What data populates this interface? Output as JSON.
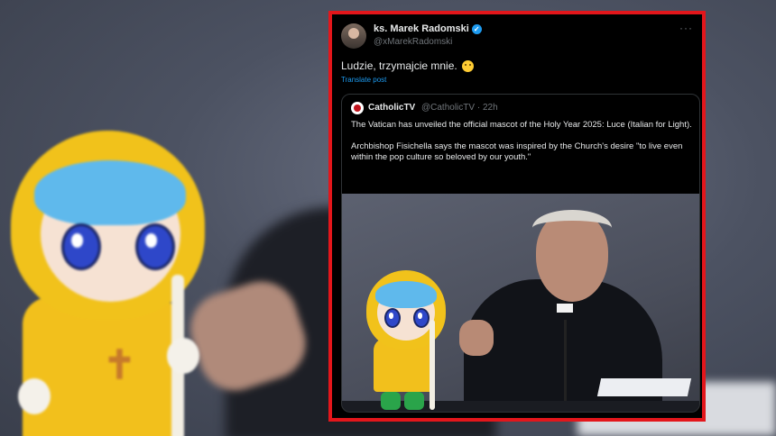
{
  "tweet": {
    "author_name": "ks. Marek Radomski",
    "author_handle": "@xMarekRadomski",
    "more_label": "···",
    "verified_mark": "✓",
    "text": "Ludzie, trzymajcie mnie.",
    "emoji_icon": "slightly-frowning-face-icon",
    "translate_label": "Translate post",
    "highlight_color": "#e3161b",
    "link_color": "#1d9bf0"
  },
  "quote": {
    "author_name": "CatholicTV",
    "author_handle": "@CatholicTV · 22h",
    "paragraph_1": "The Vatican has unveiled the official mascot of the Holy Year 2025: Luce (Italian for Light).",
    "paragraph_2": "Archbishop Fisichella says the mascot was inspired by the Church's desire \"to live even within the pop culture so beloved by our youth.\""
  }
}
